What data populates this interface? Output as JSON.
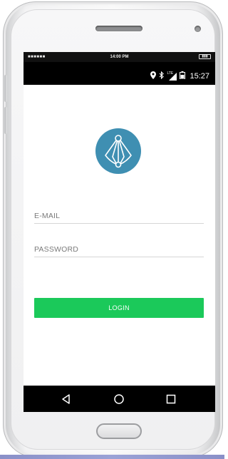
{
  "simulator_bar": {
    "signal_dots": "■■■■■■",
    "time": "14:00 PM",
    "battery_icon": "battery-full-icon"
  },
  "status_bar": {
    "icons": [
      "location-icon",
      "bluetooth-icon",
      "lte-signal-icon",
      "battery-icon"
    ],
    "lte_label": "LTE",
    "time": "15:27"
  },
  "logo": {
    "icon": "app-logo-icon",
    "color": "#3f8fb2"
  },
  "form": {
    "email_placeholder": "E-MAIL",
    "email_value": "",
    "password_placeholder": "PASSWORD",
    "password_value": "",
    "login_label": "LOGIN",
    "login_color": "#1bc95a"
  },
  "nav_bar": {
    "buttons": [
      "back-icon",
      "home-icon",
      "recent-apps-icon"
    ]
  }
}
